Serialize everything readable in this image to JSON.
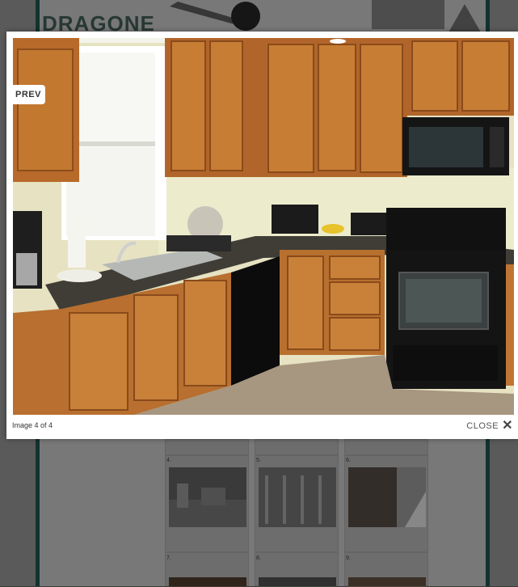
{
  "background": {
    "logo_text": "DRAGONE",
    "thumbnail_numbers": [
      "4.",
      "5.",
      "6.",
      "7.",
      "8.",
      "9."
    ]
  },
  "lightbox": {
    "prev_label": "PREV",
    "caption": "Image 4 of 4",
    "close_label": "CLOSE",
    "close_icon": "close-icon",
    "photo_subject": "kitchen-photo"
  },
  "colors": {
    "frame_border": "#1d4f49",
    "overlay": "rgba(0,0,0,0.35)"
  }
}
